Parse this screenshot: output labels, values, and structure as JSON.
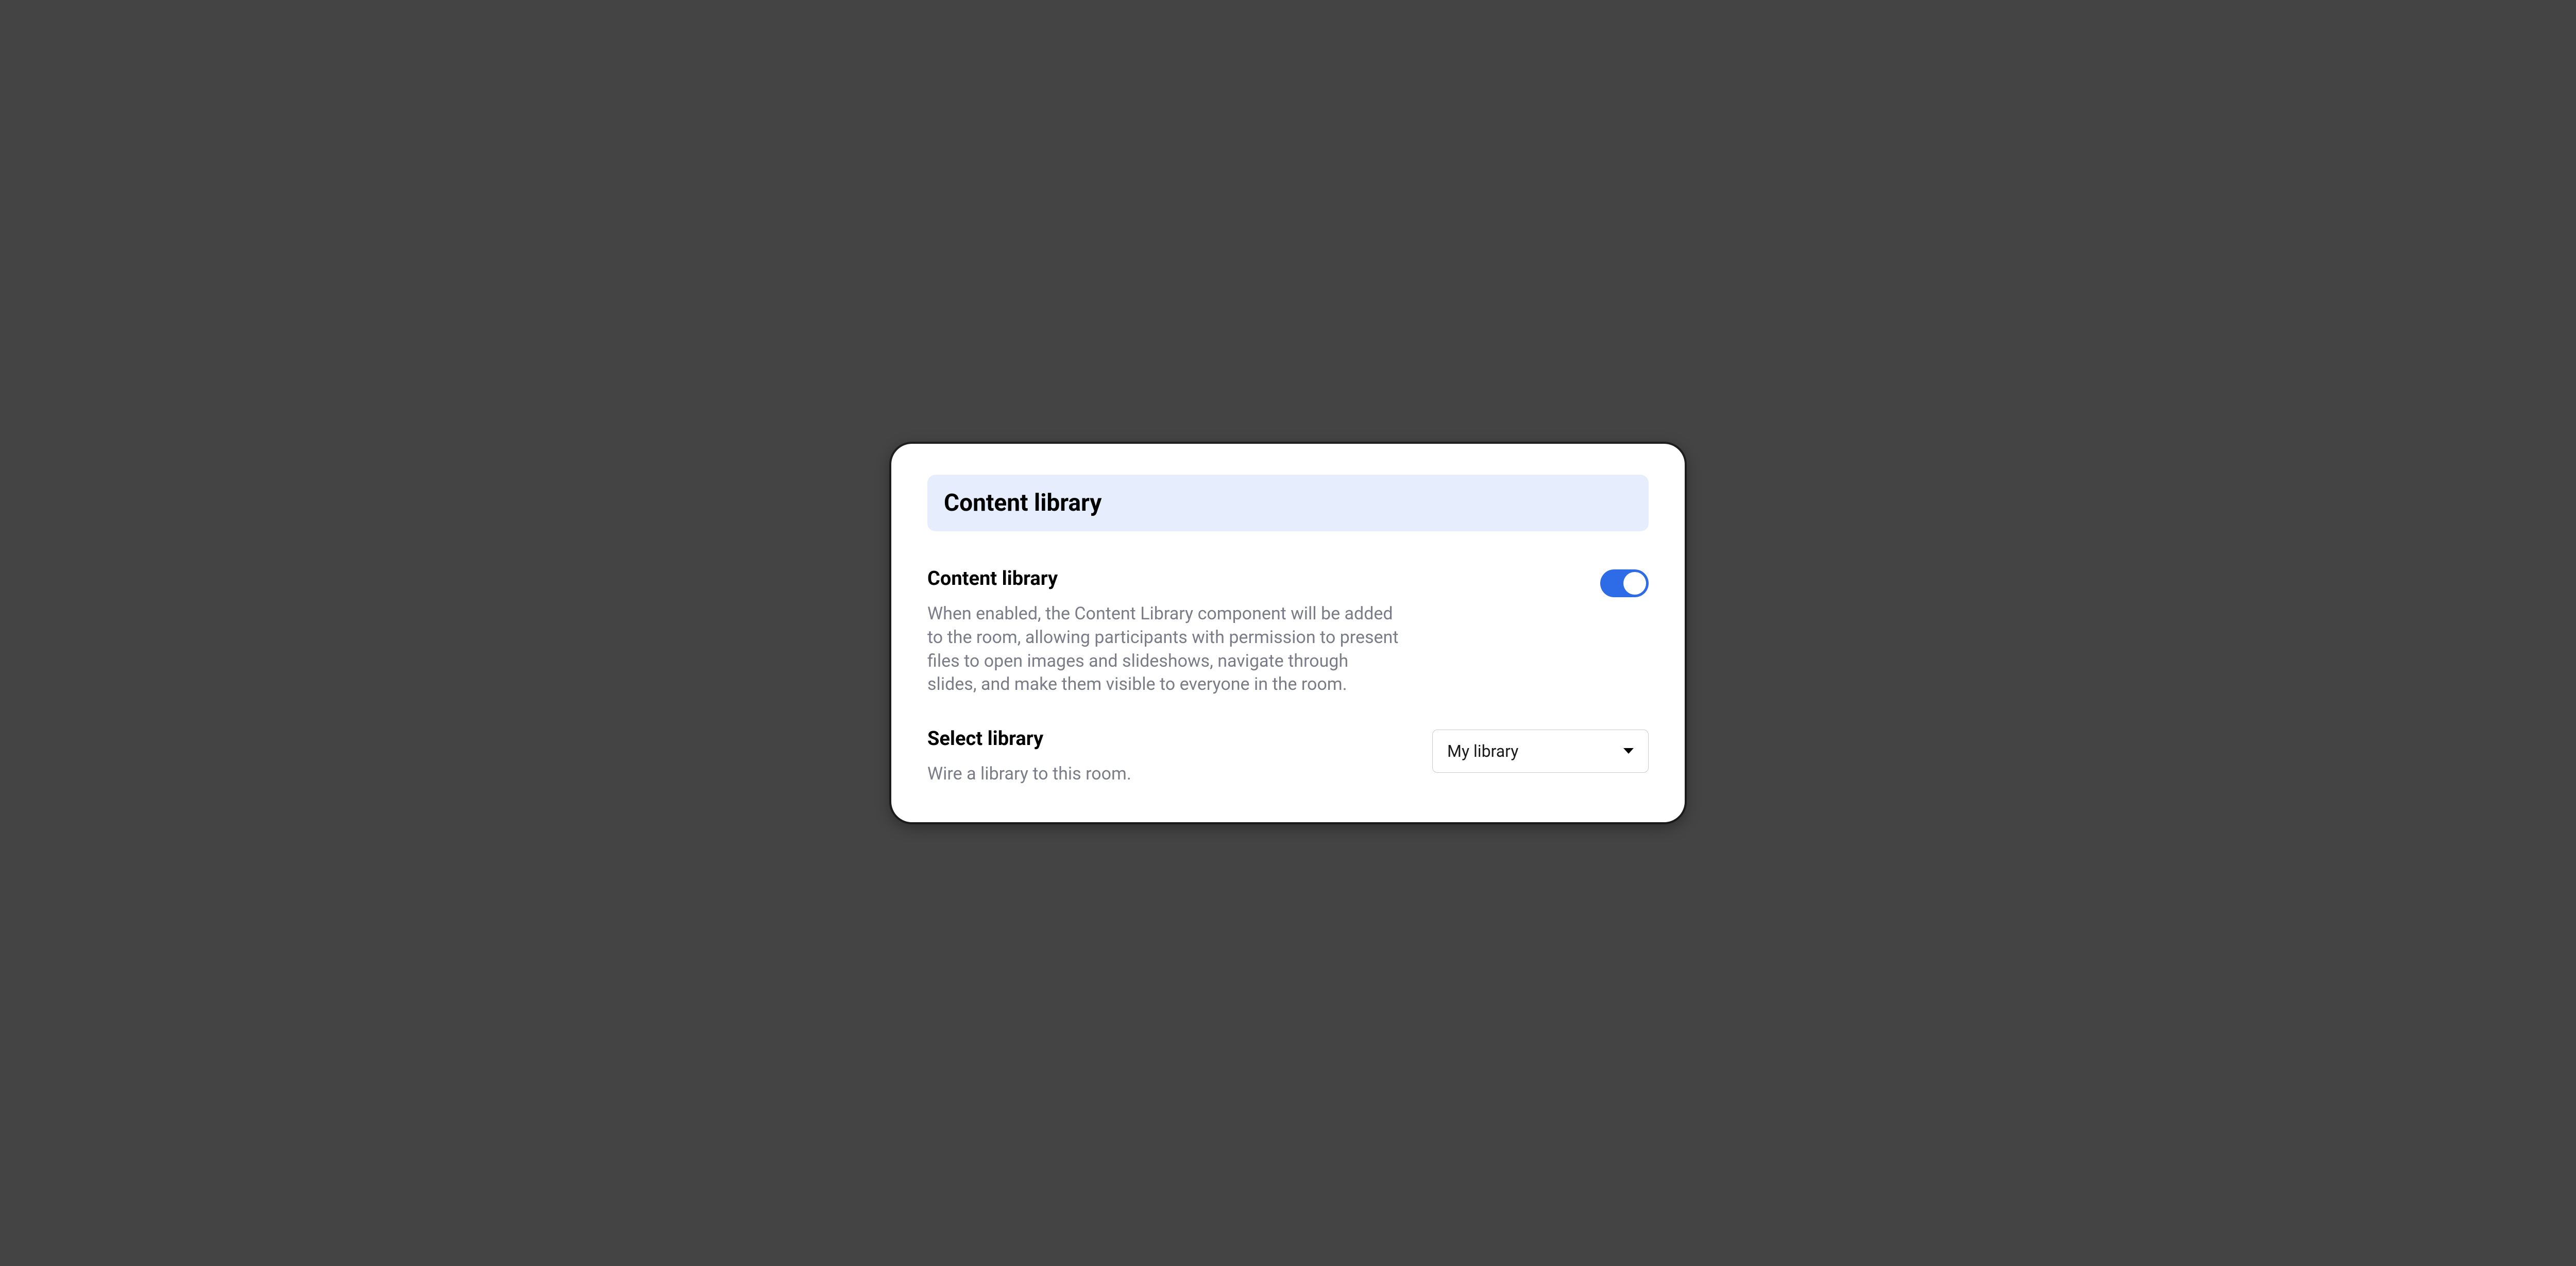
{
  "header": {
    "title": "Content library"
  },
  "settings": {
    "contentLibrary": {
      "title": "Content library",
      "description": "When enabled, the Content Library component will be added to the room, allowing participants with permission to present files to open images and slideshows, navigate through slides, and make them visible to everyone in the room.",
      "enabled": true
    },
    "selectLibrary": {
      "title": "Select library",
      "description": "Wire a library to this room.",
      "selected": "My library"
    }
  }
}
